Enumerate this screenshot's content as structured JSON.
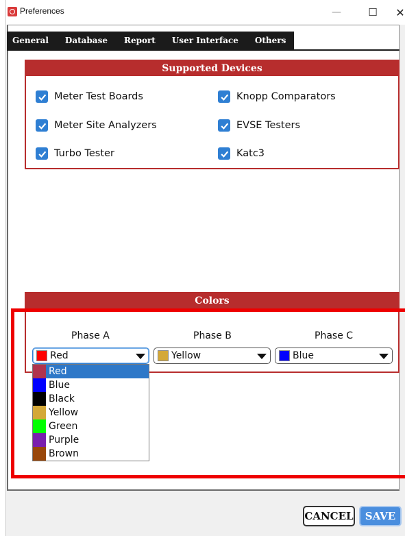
{
  "window": {
    "title": "Preferences",
    "minimize_glyph": "—",
    "maximize_glyph": "☐",
    "close_glyph": "✕"
  },
  "tabs": [
    {
      "label": "General",
      "active": true
    },
    {
      "label": "Database",
      "active": false
    },
    {
      "label": "Report",
      "active": false
    },
    {
      "label": "User Interface",
      "active": false
    },
    {
      "label": "Others",
      "active": false
    }
  ],
  "devices": {
    "header": "Supported Devices",
    "items": [
      {
        "label": "Meter Test Boards",
        "checked": true
      },
      {
        "label": "Knopp Comparators",
        "checked": true
      },
      {
        "label": "Meter Site Analyzers",
        "checked": true
      },
      {
        "label": "EVSE Testers",
        "checked": true
      },
      {
        "label": "Turbo Tester",
        "checked": true
      },
      {
        "label": "Katc3",
        "checked": true
      }
    ]
  },
  "colors": {
    "header": "Colors",
    "phases": [
      {
        "label": "Phase A",
        "value": "Red",
        "swatch": "#ff0000"
      },
      {
        "label": "Phase B",
        "value": "Yellow",
        "swatch": "#d4a838"
      },
      {
        "label": "Phase C",
        "value": "Blue",
        "swatch": "#0000ff"
      }
    ],
    "options": [
      {
        "label": "Red",
        "swatch": "#b0344e",
        "selected": true
      },
      {
        "label": "Blue",
        "swatch": "#0000ff",
        "selected": false
      },
      {
        "label": "Black",
        "swatch": "#000000",
        "selected": false
      },
      {
        "label": "Yellow",
        "swatch": "#d4a838",
        "selected": false
      },
      {
        "label": "Green",
        "swatch": "#00ff00",
        "selected": false
      },
      {
        "label": "Purple",
        "swatch": "#7a1fae",
        "selected": false
      },
      {
        "label": "Brown",
        "swatch": "#99470a",
        "selected": false
      }
    ]
  },
  "buttons": {
    "cancel": "CANCEL",
    "save": "SAVE"
  },
  "theme": {
    "accent_red": "#b72d2d",
    "accent_blue": "#2f7fd3",
    "highlight": "#ee0000"
  }
}
